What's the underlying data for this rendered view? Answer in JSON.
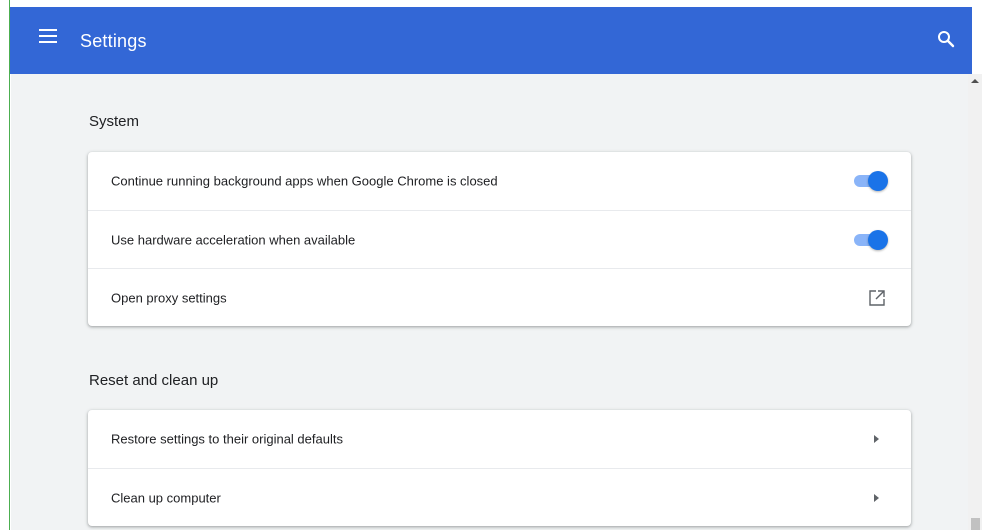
{
  "header": {
    "title": "Settings",
    "menu_icon": "hamburger-menu-icon",
    "search_icon": "search-icon",
    "color": "#3367d6"
  },
  "system": {
    "title": "System",
    "rows": [
      {
        "label": "Continue running background apps when Google Chrome is closed",
        "control": "toggle",
        "checked": true
      },
      {
        "label": "Use hardware acceleration when available",
        "control": "toggle",
        "checked": true
      },
      {
        "label": "Open proxy settings",
        "control": "external-link-icon"
      }
    ]
  },
  "reset": {
    "title": "Reset and clean up",
    "rows": [
      {
        "label": "Restore settings to their original defaults",
        "control": "chevron-right-icon"
      },
      {
        "label": "Clean up computer",
        "control": "chevron-right-icon"
      }
    ]
  },
  "colors": {
    "accent": "#1a73e8",
    "toggle_track": "#8ab4f8",
    "background": "#f1f3f4"
  }
}
